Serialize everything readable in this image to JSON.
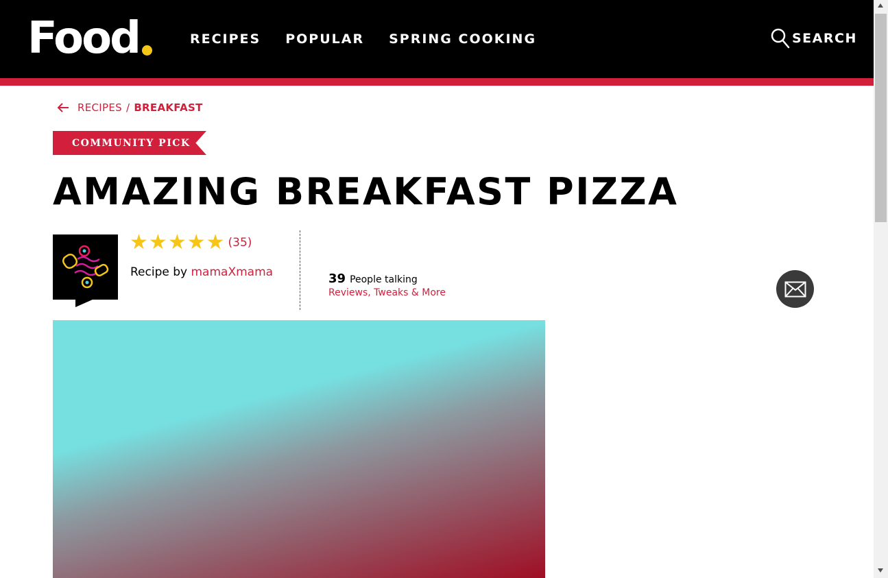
{
  "header": {
    "logo_text": "Food",
    "logo_dot_color": "#f5c518",
    "nav": [
      "RECIPES",
      "POPULAR",
      "SPRING COOKING"
    ],
    "search_label": "SEARCH",
    "accent_color": "#d21f3c"
  },
  "breadcrumb": {
    "back_icon": "arrow-left-icon",
    "parent": "RECIPES",
    "separator": "/",
    "current": "BREAKFAST"
  },
  "badge": "COMMUNITY PICK",
  "recipe": {
    "title": "AMAZING BREAKFAST PIZZA",
    "rating": 5,
    "rating_count": "(35)",
    "byline_prefix": "Recipe by",
    "author": "mamaXmama"
  },
  "discussion": {
    "count": "39",
    "label": "People talking",
    "link": "Reviews, Tweaks & More"
  },
  "mail_icon": "envelope-icon"
}
